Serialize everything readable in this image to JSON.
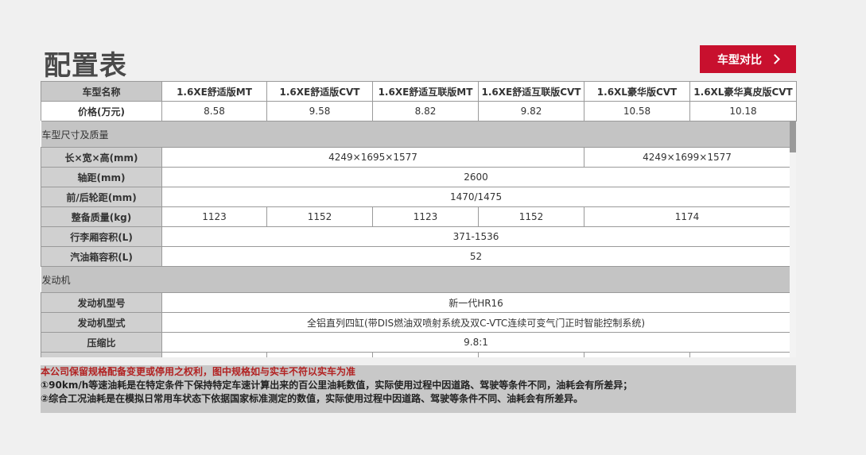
{
  "page_title": "配置表",
  "compare_button": {
    "label": "车型对比"
  },
  "header": {
    "model_label": "车型名称",
    "models": [
      "1.6XE舒适版MT",
      "1.6XE舒适版CVT",
      "1.6XE舒适互联版MT",
      "1.6XE舒适互联版CVT",
      "1.6XL豪华版CVT",
      "1.6XL豪华真皮版CVT"
    ],
    "price_label": "价格(万元)",
    "prices": [
      "8.58",
      "9.58",
      "8.82",
      "9.82",
      "10.58",
      "10.18"
    ]
  },
  "sections": {
    "dimensions": {
      "title": "车型尺寸及质量",
      "rows": {
        "size": {
          "label": "长×宽×高(mm)",
          "values": [
            "4249×1695×1577",
            "4249×1699×1577"
          ]
        },
        "wheelbase": {
          "label": "轴距(mm)",
          "value": "2600"
        },
        "track": {
          "label": "前/后轮距(mm)",
          "value": "1470/1475"
        },
        "weight": {
          "label": "整备质量(kg)",
          "values": [
            "1123",
            "1152",
            "1123",
            "1152",
            "1174"
          ]
        },
        "trunk": {
          "label": "行李厢容积(L)",
          "value": "371-1536"
        },
        "tank": {
          "label": "汽油箱容积(L)",
          "value": "52"
        }
      }
    },
    "engine": {
      "title": "发动机",
      "rows": {
        "model": {
          "label": "发动机型号",
          "value": "新一代HR16"
        },
        "type": {
          "label": "发动机型式",
          "value": "全铝直列四缸(带DIS燃油双喷射系统及双C-VTC连续可变气门正时智能控制系统)"
        },
        "compression": {
          "label": "压缩比",
          "value": "9.8:1"
        }
      }
    }
  },
  "notes": {
    "disclaimer": "本公司保留规格配备变更或停用之权利，图中规格如与实车不符以实车为准",
    "note1": "①90km/h等速油耗是在特定条件下保持特定车速计算出来的百公里油耗数值，实际使用过程中因道路、驾驶等条件不同，油耗会有所差异；",
    "note2": "②综合工况油耗是在模拟日常用车状态下依据国家标准测定的数值，实际使用过程中因道路、驾驶等条件不同、油耗会有所差异。"
  }
}
